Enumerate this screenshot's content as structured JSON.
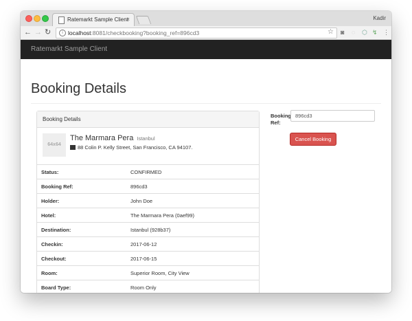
{
  "browser": {
    "tab_title": "Ratemarkt Sample Client",
    "tab_close": "×",
    "profile_name": "Kadir",
    "nav": {
      "back": "←",
      "forward": "→",
      "reload": "↻"
    },
    "url_host": "localhost",
    "url_rest": ":8081/checkbooking?booking_ref=896cd3",
    "star": "☆",
    "extensions": [
      "◙",
      "◌",
      "⬡",
      "↯",
      "⋮"
    ]
  },
  "navbar": {
    "brand": "Ratemarkt Sample Client"
  },
  "page": {
    "title": "Booking Details"
  },
  "panel": {
    "heading": "Booking Details",
    "thumb_label": "64x64",
    "hotel_name": "The Marmara Pera",
    "hotel_city": "Istanbul",
    "address": "88 Colin P. Kelly Street, San Francisco, CA 94107.",
    "rows": [
      {
        "label": "Status:",
        "value": "CONFIRMED"
      },
      {
        "label": "Booking Ref:",
        "value": "896cd3"
      },
      {
        "label": "Holder:",
        "value": "John Doe"
      },
      {
        "label": "Hotel:",
        "value": "The Marmara Pera (0aef99)"
      },
      {
        "label": "Destination:",
        "value": "Istanbul (928b37)"
      },
      {
        "label": "Checkin:",
        "value": "2017-06-12"
      },
      {
        "label": "Checkout:",
        "value": "2017-06-15"
      },
      {
        "label": "Room:",
        "value": "Superior Room, City View"
      },
      {
        "label": "Board Type:",
        "value": "Room Only"
      }
    ]
  },
  "form": {
    "ref_label": "Booking Ref:",
    "ref_value": "896cd3",
    "cancel_label": "Cancel Booking"
  },
  "colors": {
    "navbar": "#222222",
    "danger": "#d9534f"
  }
}
